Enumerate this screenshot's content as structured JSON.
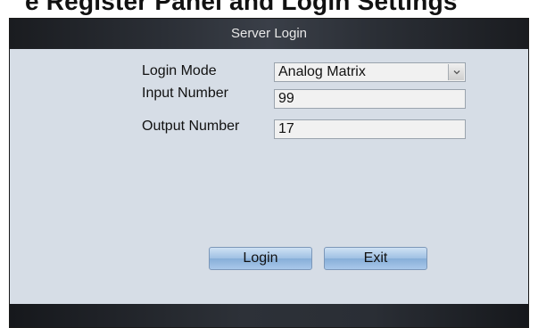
{
  "page": {
    "caption": "e Register Panel and Login Settings"
  },
  "dialog": {
    "title": "Server Login",
    "fields": [
      {
        "label": "Login Mode",
        "value": "Analog Matrix",
        "type": "select"
      },
      {
        "label": "Input Number",
        "value": "99",
        "type": "text"
      },
      {
        "label": "Output Number",
        "value": "17",
        "type": "text"
      }
    ],
    "buttons": {
      "login": "Login",
      "exit": "Exit"
    },
    "icons": {
      "dropdown": "chevron-down-icon"
    },
    "colors": {
      "background": "#d6dde6",
      "titlebar": "#2b2f36",
      "button": "#9fc0e3"
    }
  }
}
